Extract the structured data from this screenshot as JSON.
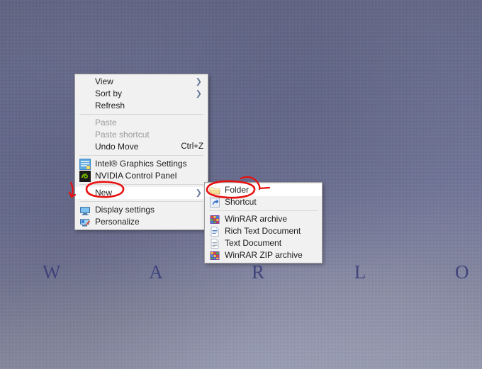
{
  "desktop": {
    "wordmark": "W A R L O C K"
  },
  "context_menu": {
    "name": "desktop-context-menu",
    "items": [
      {
        "label": "View",
        "icon": "",
        "submenu": true,
        "disabled": false,
        "accel": ""
      },
      {
        "label": "Sort by",
        "icon": "",
        "submenu": true,
        "disabled": false,
        "accel": ""
      },
      {
        "label": "Refresh",
        "icon": "",
        "submenu": false,
        "disabled": false,
        "accel": ""
      },
      {
        "separator": true
      },
      {
        "label": "Paste",
        "icon": "",
        "submenu": false,
        "disabled": true,
        "accel": ""
      },
      {
        "label": "Paste shortcut",
        "icon": "",
        "submenu": false,
        "disabled": true,
        "accel": ""
      },
      {
        "label": "Undo Move",
        "icon": "",
        "submenu": false,
        "disabled": false,
        "accel": "Ctrl+Z"
      },
      {
        "separator": true
      },
      {
        "label": "Intel® Graphics Settings",
        "icon": "intel-graphics-icon",
        "submenu": false,
        "disabled": false,
        "accel": ""
      },
      {
        "label": "NVIDIA Control Panel",
        "icon": "nvidia-icon",
        "submenu": false,
        "disabled": false,
        "accel": ""
      },
      {
        "separator": true
      },
      {
        "label": "New",
        "icon": "",
        "submenu": true,
        "disabled": false,
        "accel": "",
        "highlighted": true
      },
      {
        "separator": true
      },
      {
        "label": "Display settings",
        "icon": "display-icon",
        "submenu": false,
        "disabled": false,
        "accel": ""
      },
      {
        "label": "Personalize",
        "icon": "personalize-icon",
        "submenu": false,
        "disabled": false,
        "accel": ""
      }
    ]
  },
  "new_submenu": {
    "name": "new-submenu",
    "items": [
      {
        "label": "Folder",
        "icon": "folder-icon",
        "hover": true
      },
      {
        "label": "Shortcut",
        "icon": "shortcut-icon",
        "hover": false
      },
      {
        "separator": true
      },
      {
        "label": "WinRAR archive",
        "icon": "winrar-icon",
        "hover": false
      },
      {
        "label": "Rich Text Document",
        "icon": "rtf-icon",
        "hover": false
      },
      {
        "label": "Text Document",
        "icon": "txt-icon",
        "hover": false
      },
      {
        "label": "WinRAR ZIP archive",
        "icon": "winrar-zip-icon",
        "hover": false
      }
    ]
  },
  "annotations": {
    "marker_color": "#e8100f",
    "shapes": [
      {
        "name": "ellipse-around-new",
        "target": "New"
      },
      {
        "name": "ellipse-around-folder",
        "target": "Folder"
      },
      {
        "name": "arrow-left-to-new",
        "target": "New"
      },
      {
        "name": "arrow-right-to-folder",
        "target": "Folder"
      }
    ]
  }
}
